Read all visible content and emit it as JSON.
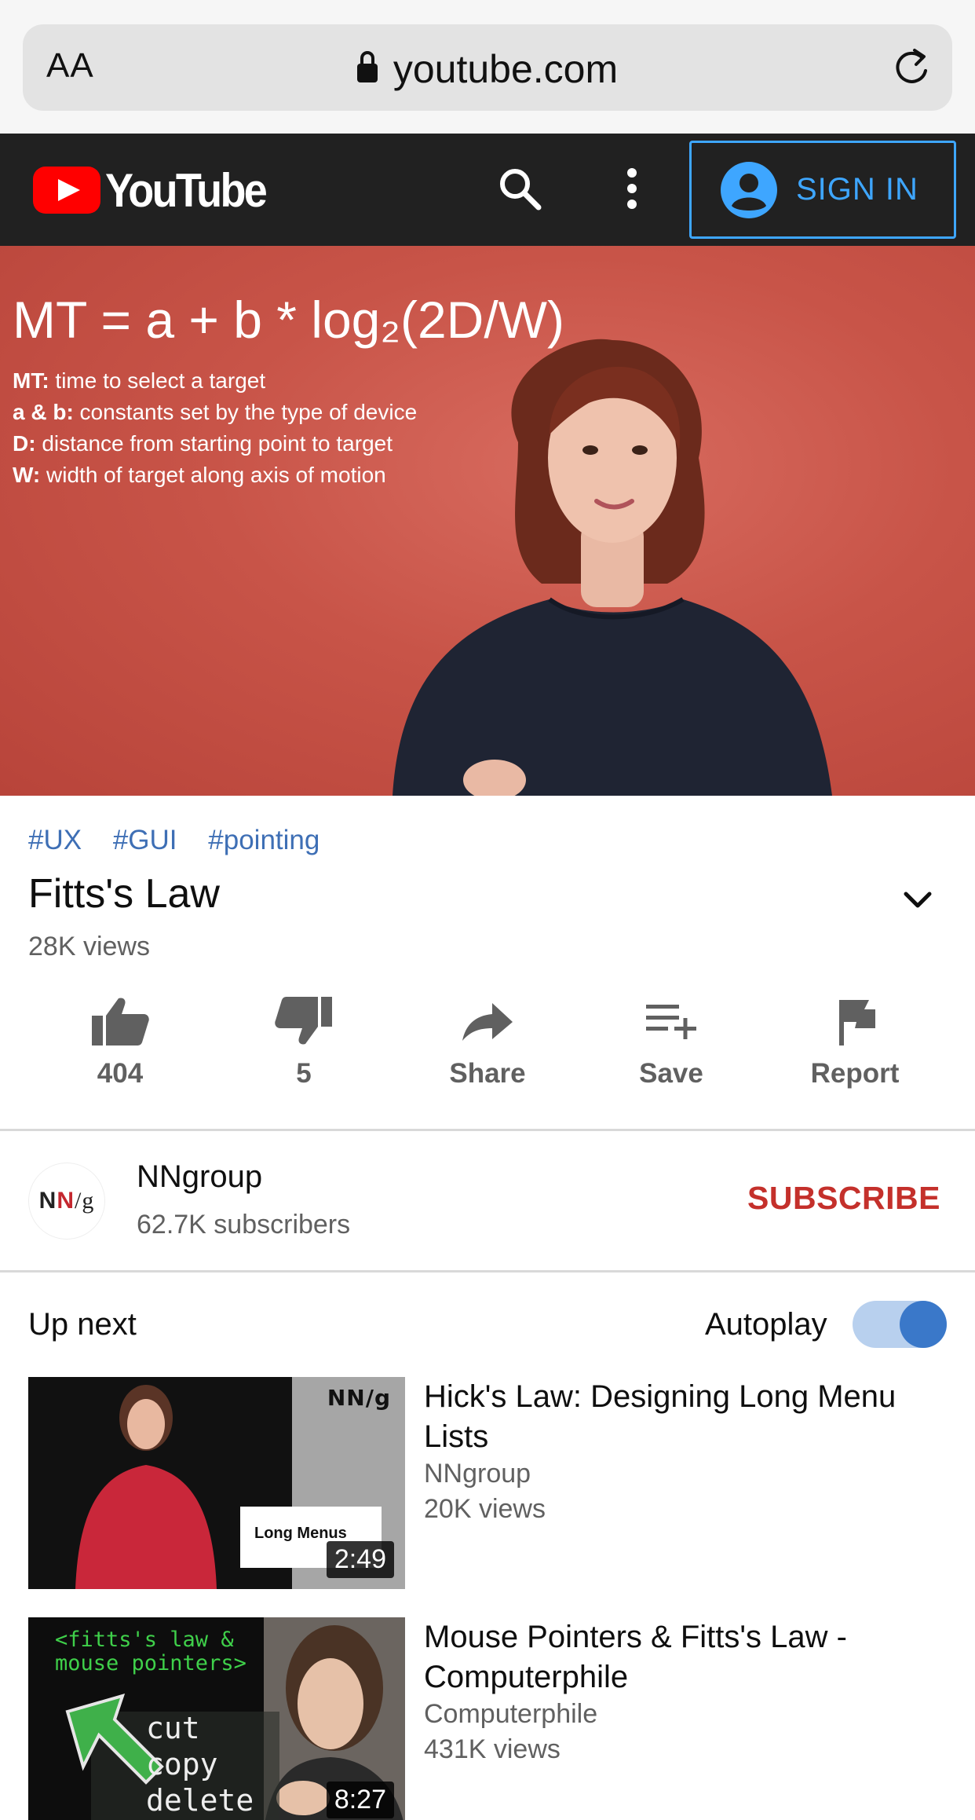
{
  "browser": {
    "text_size_label": "AA",
    "url": "youtube.com"
  },
  "header": {
    "logo_text": "YouTube",
    "sign_in_label": "SIGN IN"
  },
  "video": {
    "formula": "MT = a + b * log₂(2D/W)",
    "formula_lines": [
      {
        "term": "MT:",
        "text": " time to select a target"
      },
      {
        "term": "a & b:",
        "text": " constants set by the type of device"
      },
      {
        "term": "D:",
        "text": " distance from starting point to target"
      },
      {
        "term": "W:",
        "text": " width of target along axis of motion"
      }
    ],
    "tags": [
      "#UX",
      "#GUI",
      "#pointing"
    ],
    "title": "Fitts's Law",
    "views": "28K views",
    "actions": {
      "like": "404",
      "dislike": "5",
      "share": "Share",
      "save": "Save",
      "report": "Report"
    }
  },
  "channel": {
    "name": "NNgroup",
    "subscribers": "62.7K subscribers",
    "subscribe_label": "SUBSCRIBE"
  },
  "up_next": {
    "heading": "Up next",
    "autoplay_label": "Autoplay",
    "autoplay_on": true,
    "items": [
      {
        "title": "Hick's Law: Designing Long Menu Lists",
        "channel": "NNgroup",
        "views": "20K views",
        "duration": "2:49",
        "thumb_caption": "Long Menus",
        "thumb_logo": "NN/g"
      },
      {
        "title": "Mouse Pointers & Fitts's Law - Computerphile",
        "channel": "Computerphile",
        "views": "431K views",
        "duration": "8:27",
        "thumb_text_top": "<fitts's law &",
        "thumb_text_bottom": "mouse pointers>",
        "thumb_words": [
          "cut",
          "copy",
          "delete"
        ]
      }
    ]
  },
  "colors": {
    "accent_blue": "#3ea6ff",
    "subscribe_red": "#c4302b",
    "header_bg": "#212121",
    "tag_blue": "#3e6fb5"
  }
}
